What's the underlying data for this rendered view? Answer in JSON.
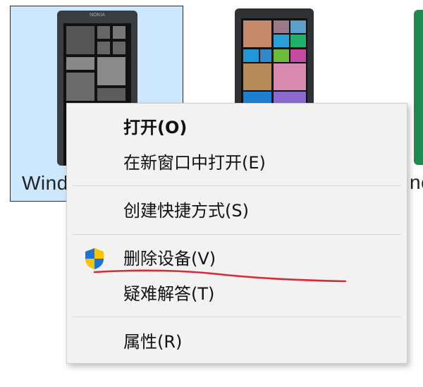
{
  "devices": [
    {
      "label": "Wind"
    },
    {
      "label": ""
    },
    {
      "label": "no"
    }
  ],
  "phone": {
    "brand": "NOKIA"
  },
  "menu": {
    "items": [
      {
        "label": "打开(O)",
        "icon": null
      },
      {
        "label": "在新窗口中打开(E)",
        "icon": null
      },
      {
        "label": "创建快捷方式(S)",
        "icon": null
      },
      {
        "label": "删除设备(V)",
        "icon": "uac-shield-icon"
      },
      {
        "label": "疑难解答(T)",
        "icon": null
      },
      {
        "label": "属性(R)",
        "icon": null
      }
    ]
  },
  "colors": {
    "selection": "#cce8ff",
    "menu_bg": "#f2f2f2",
    "annotation": "#e0262e"
  }
}
